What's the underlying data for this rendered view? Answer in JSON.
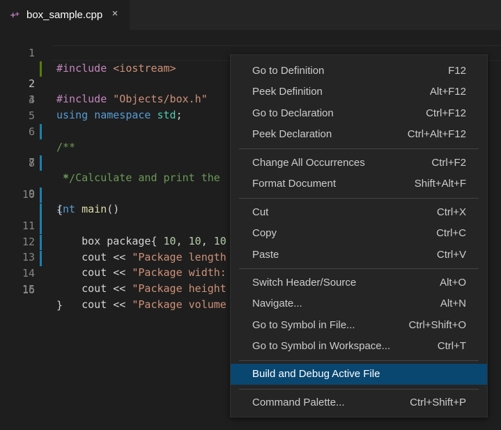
{
  "tab": {
    "label": "box_sample.cpp",
    "close": "×"
  },
  "editor": {
    "line_numbers": [
      "1",
      "2",
      "3",
      "4",
      "5",
      "6",
      "7",
      "8",
      "9",
      "10",
      "11",
      "12",
      "13",
      "14",
      "15",
      "16"
    ],
    "lines": {
      "l1": {
        "a": "#include ",
        "b": "<iostream>"
      },
      "l2": {
        "a": "#include ",
        "b": "\"Objects/box.h\""
      },
      "l4": {
        "a": "using",
        "b": "namespace",
        "c": "std",
        "d": ";"
      },
      "l6": {
        "a": "/**"
      },
      "l7": {
        "a": " * Calculate and print the"
      },
      "l8": {
        "a": " */"
      },
      "l9": {
        "a": "int",
        "b": "main",
        "c": "()"
      },
      "l10": {
        "a": "{"
      },
      "l11": {
        "a": "    box package{ ",
        "b": "10",
        "c": ", ",
        "d": "10",
        "e": ", ",
        "f": "10"
      },
      "l12": {
        "a": "    cout << ",
        "b": "\"Package length"
      },
      "l13": {
        "a": "    cout << ",
        "b": "\"Package width:"
      },
      "l14": {
        "a": "    cout << ",
        "b": "\"Package height"
      },
      "l15": {
        "a": "    cout << ",
        "b": "\"Package volume"
      },
      "l16": {
        "a": "}"
      }
    }
  },
  "context_menu": {
    "items": [
      {
        "label": "Go to Definition",
        "shortcut": "F12"
      },
      {
        "label": "Peek Definition",
        "shortcut": "Alt+F12"
      },
      {
        "label": "Go to Declaration",
        "shortcut": "Ctrl+F12"
      },
      {
        "label": "Peek Declaration",
        "shortcut": "Ctrl+Alt+F12"
      },
      {
        "label": "Change All Occurrences",
        "shortcut": "Ctrl+F2"
      },
      {
        "label": "Format Document",
        "shortcut": "Shift+Alt+F"
      },
      {
        "label": "Cut",
        "shortcut": "Ctrl+X"
      },
      {
        "label": "Copy",
        "shortcut": "Ctrl+C"
      },
      {
        "label": "Paste",
        "shortcut": "Ctrl+V"
      },
      {
        "label": "Switch Header/Source",
        "shortcut": "Alt+O"
      },
      {
        "label": "Navigate...",
        "shortcut": "Alt+N"
      },
      {
        "label": "Go to Symbol in File...",
        "shortcut": "Ctrl+Shift+O"
      },
      {
        "label": "Go to Symbol in Workspace...",
        "shortcut": "Ctrl+T"
      },
      {
        "label": "Build and Debug Active File",
        "shortcut": "",
        "highlighted": true
      },
      {
        "label": "Command Palette...",
        "shortcut": "Ctrl+Shift+P"
      }
    ]
  },
  "colors": {
    "editor_bg": "#1e1e1e",
    "menu_bg": "#252526",
    "menu_highlight": "#094771",
    "gutter_modified": "#1b81a8",
    "gutter_added": "#587c0c"
  },
  "icons": {
    "tab_file_icon": "cpp-file-icon",
    "tab_close": "close-icon"
  }
}
